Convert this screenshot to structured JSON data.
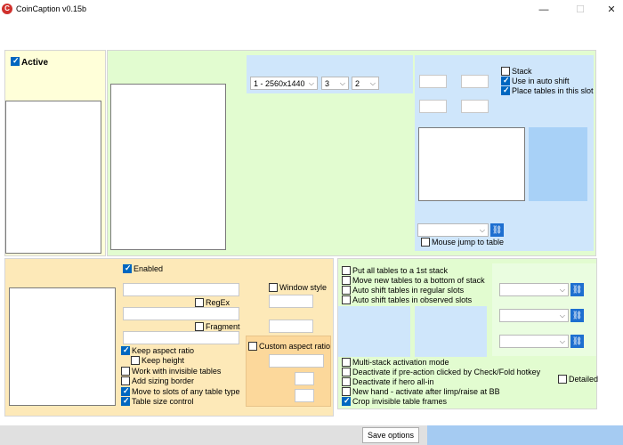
{
  "window": {
    "title": "CoinCaption v0.15b",
    "minimize_glyph": "—",
    "maximize_glyph": "☐",
    "close_glyph": "✕",
    "icon_letter": "C"
  },
  "left_top": {
    "active_label": "Active",
    "active_checked": true
  },
  "layout_panel": {
    "resolution_select": "1 - 2560x1440",
    "cols_select": "3",
    "rows_select": "2"
  },
  "slot_panel": {
    "stack_label": "Stack",
    "stack_checked": false,
    "auto_shift_label": "Use in auto shift",
    "auto_shift_checked": true,
    "place_tables_label": "Place tables in this slot",
    "place_tables_checked": true,
    "mouse_jump_label": "Mouse jump to table",
    "mouse_jump_checked": false,
    "slot_select": ""
  },
  "filter_panel": {
    "enabled_label": "Enabled",
    "enabled_checked": true,
    "regex_label": "RegEx",
    "regex_checked": false,
    "fragment_label": "Fragment",
    "fragment_checked": false,
    "window_style_label": "Window style",
    "window_style_checked": false,
    "custom_aspect_label": "Custom aspect ratio",
    "custom_aspect_checked": false,
    "options": [
      {
        "label": "Keep aspect ratio",
        "checked": true
      },
      {
        "label": "Keep height",
        "checked": false
      },
      {
        "label": "Work with invisible tables",
        "checked": false
      },
      {
        "label": "Add sizing border",
        "checked": false
      },
      {
        "label": "Move to slots of any table type",
        "checked": true
      },
      {
        "label": "Table size control",
        "checked": true
      }
    ]
  },
  "stack_panel": {
    "options_top": [
      {
        "label": "Put all tables to a 1st stack",
        "checked": false
      },
      {
        "label": "Move new tables to a bottom of stack",
        "checked": false
      },
      {
        "label": "Auto shift tables in regular slots",
        "checked": false
      },
      {
        "label": "Auto shift tables in observed slots",
        "checked": false
      }
    ],
    "options_bottom": [
      {
        "label": "Multi-stack activation mode",
        "checked": false
      },
      {
        "label": "Deactivate if pre-action clicked by Check/Fold hotkey",
        "checked": false
      },
      {
        "label": "Deactivate if hero all-in",
        "checked": false
      },
      {
        "label": "New hand - activate after limp/raise at BB",
        "checked": false
      },
      {
        "label": "Crop invisible table frames",
        "checked": true
      }
    ],
    "detailed_label": "Detailed",
    "detailed_checked": false
  },
  "footer": {
    "save_label": "Save options"
  },
  "icons": {
    "chain": "⛓"
  },
  "colors": {
    "yellow_panel": "#ffffd9",
    "green_panel": "#e2fcd0",
    "blue_panel": "#cfe6fb",
    "orange_panel": "#fde9b8",
    "blue_fill": "#a8d1f7",
    "accent": "#0067c0"
  }
}
